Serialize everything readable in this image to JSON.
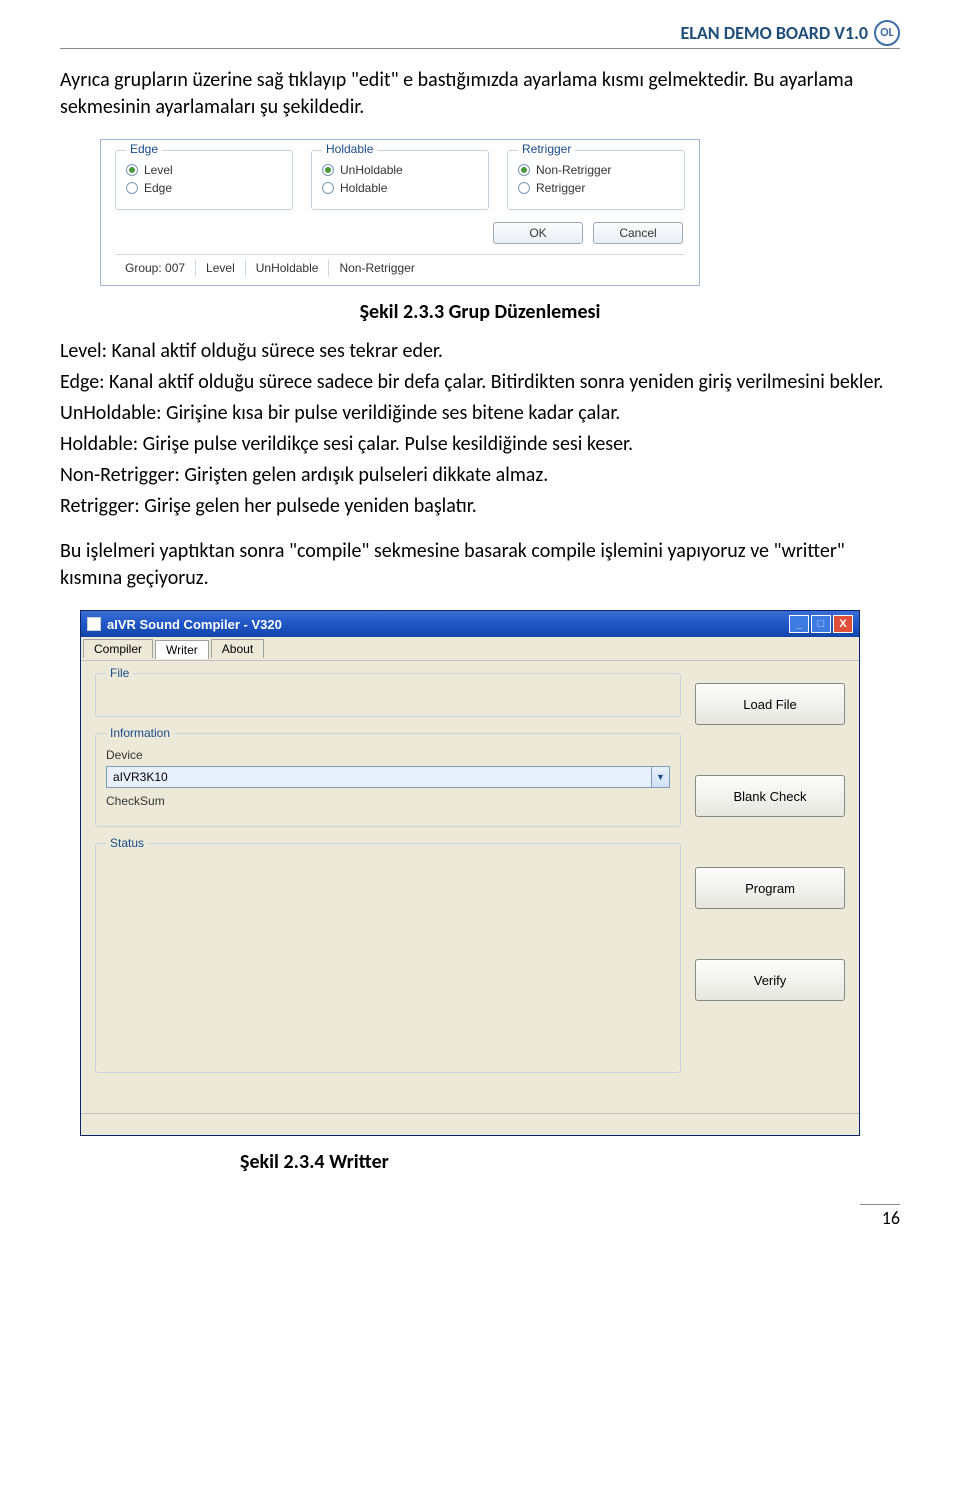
{
  "header": {
    "title": "ELAN DEMO BOARD V1.0",
    "badge": "OL"
  },
  "p1": "Ayrıca grupların üzerine sağ tıklayıp \"edit\" e bastığımızda ayarlama kısmı gelmektedir. Bu ayarlama sekmesinin ayarlamaları şu şekildedir.",
  "shot1": {
    "g1": {
      "legend": "Edge",
      "o1": "Level",
      "o2": "Edge"
    },
    "g2": {
      "legend": "Holdable",
      "o1": "UnHoldable",
      "o2": "Holdable"
    },
    "g3": {
      "legend": "Retrigger",
      "o1": "Non-Retrigger",
      "o2": "Retrigger"
    },
    "ok": "OK",
    "cancel": "Cancel",
    "s1": "Group: 007",
    "s2": "Level",
    "s3": "UnHoldable",
    "s4": "Non-Retrigger"
  },
  "cap1": "Şekil 2.3.3 Grup Düzenlemesi",
  "desc": {
    "l1": "Level: Kanal aktif olduğu sürece ses tekrar eder.",
    "l2": "Edge: Kanal aktif olduğu sürece sadece bir defa çalar. Bitirdikten sonra yeniden giriş verilmesini bekler.",
    "l3": "UnHoldable: Girişine kısa bir pulse verildiğinde ses bitene kadar çalar.",
    "l4": "Holdable: Girişe pulse verildikçe sesi çalar. Pulse kesildiğinde sesi keser.",
    "l5": "Non-Retrigger: Girişten gelen ardışık pulseleri dikkate almaz.",
    "l6": "Retrigger: Girişe gelen her pulsede yeniden başlatır."
  },
  "p2": "Bu işlelmeri yaptıktan sonra \"compile\" sekmesine basarak compile işlemini yapıyoruz ve \"writter\" kısmına geçiyoruz.",
  "shot2": {
    "title": "aIVR Sound Compiler  -  V320",
    "tabs": {
      "t1": "Compiler",
      "t2": "Writer",
      "t3": "About"
    },
    "file": "File",
    "info": "Information",
    "device": "Device",
    "device_val": "aIVR3K10",
    "checksum": "CheckSum",
    "status": "Status",
    "b_load": "Load File",
    "b_blank": "Blank Check",
    "b_prog": "Program",
    "b_verify": "Verify"
  },
  "cap2": "Şekil 2.3.4 Writter",
  "pagenum": "16"
}
